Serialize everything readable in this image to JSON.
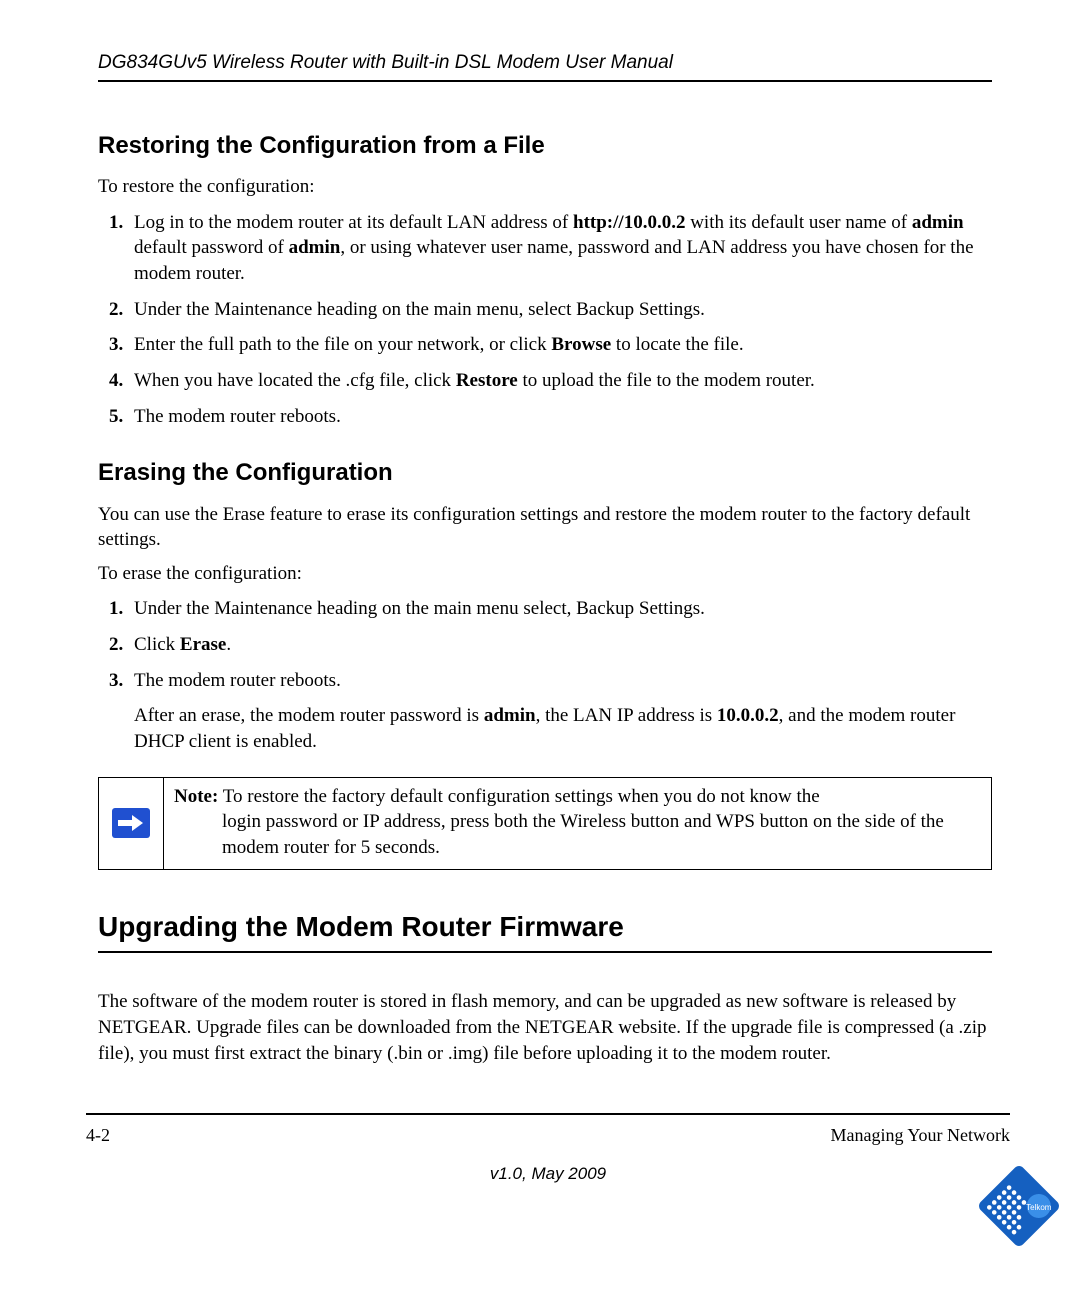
{
  "header": {
    "running": "DG834GUv5 Wireless Router with Built-in DSL Modem User Manual"
  },
  "section_restore": {
    "heading": "Restoring the Configuration from a File",
    "intro": "To restore the configuration:",
    "step1": {
      "pre_url": "Log in to the modem router at its default LAN address of ",
      "url": "http://10.0.0.2",
      "post_url": " with its default user name of ",
      "user": "admin",
      "mid": " default password of ",
      "pass": "admin",
      "tail": ", or using whatever user name, password and LAN address you have chosen for the modem router."
    },
    "step2": "Under the Maintenance heading on the main menu, select Backup Settings.",
    "step3": {
      "pre": "Enter the full path to the file on your network, or click ",
      "b": "Browse",
      "post": " to locate the file."
    },
    "step4": {
      "pre": "When you have located the .cfg file, click ",
      "b": "Restore",
      "post": " to upload the file to the modem router."
    },
    "step5": "The modem router reboots."
  },
  "section_erase": {
    "heading": "Erasing the Configuration",
    "intro_p": "You can use the Erase feature to erase its configuration settings and restore the modem router to the factory default settings.",
    "intro2": "To erase the configuration:",
    "step1": "Under the Maintenance heading on the main menu select, Backup Settings.",
    "step2_pre": "Click ",
    "step2_b": "Erase",
    "step2_post": ".",
    "step3": "The modem router reboots.",
    "step3_sub": {
      "pre": "After an erase, the modem router password is ",
      "b1": "admin",
      "mid": ", the LAN IP address is ",
      "b2": "10.0.0.2",
      "post": ", and the modem router DHCP client is enabled."
    }
  },
  "note": {
    "label": "Note:",
    "first_line": " To restore the factory default configuration settings when you do not know the",
    "rest": "login password or IP address, press both the Wireless button and WPS button on the side of the modem router for 5 seconds."
  },
  "section_upgrade": {
    "heading": "Upgrading the Modem Router Firmware",
    "body": "The software of the modem router is stored in flash memory, and can be upgraded as new software is released by NETGEAR. Upgrade files can be downloaded from the NETGEAR website. If the upgrade file is compressed (a .zip file), you must first extract the binary (.bin or .img) file before uploading it to the modem router."
  },
  "footer": {
    "page_num": "4-2",
    "chapter": "Managing Your Network",
    "version": "v1.0, May 2009"
  },
  "logo": {
    "name": "Telkom"
  }
}
